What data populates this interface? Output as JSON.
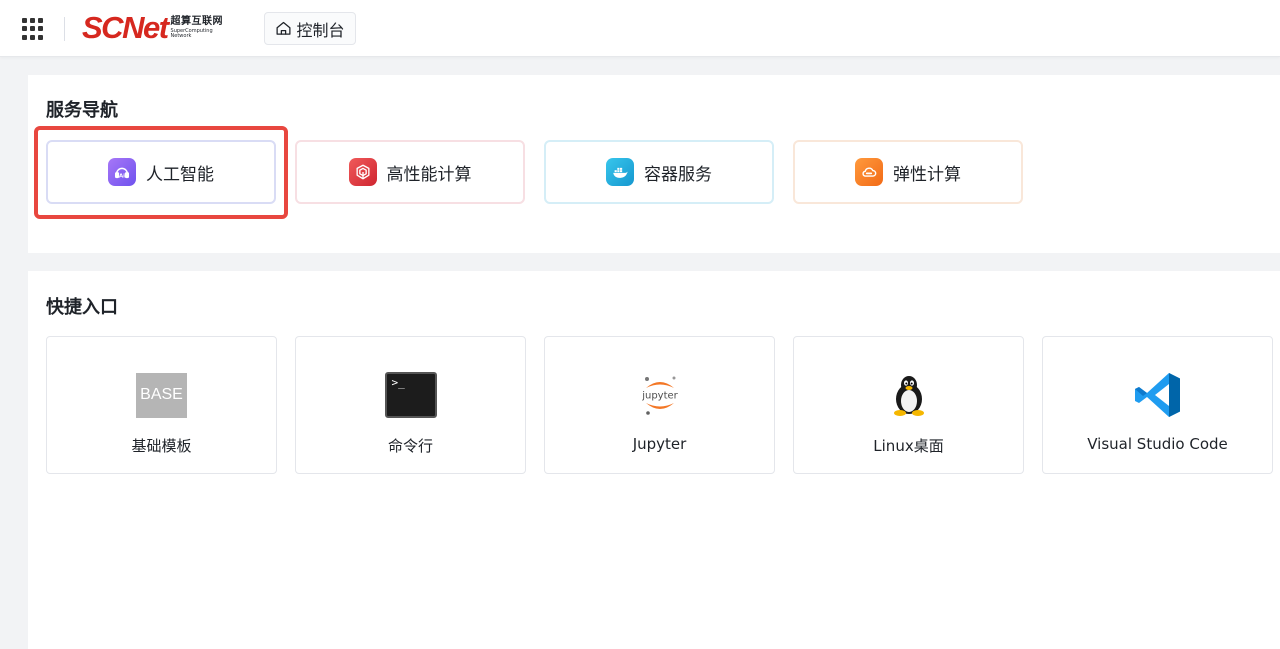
{
  "header": {
    "logo_main": "SCNet",
    "logo_cn": "超算互联网",
    "logo_en_line1": "SuperComputing",
    "logo_en_line2": "Network",
    "console_label": "控制台"
  },
  "service_nav": {
    "title": "服务导航",
    "items": [
      {
        "label": "人工智能",
        "icon": "ai-icon",
        "border_color": "#d9dcf5",
        "icon_color": "#7b5cf5"
      },
      {
        "label": "高性能计算",
        "icon": "hpc-icon",
        "border_color": "#f7dfe3",
        "icon_color": "#e0383e"
      },
      {
        "label": "容器服务",
        "icon": "docker-icon",
        "border_color": "#d5eef7",
        "icon_color": "#1ba7d9"
      },
      {
        "label": "弹性计算",
        "icon": "cloud-icon",
        "border_color": "#f9e7d9",
        "icon_color": "#f6771f"
      }
    ]
  },
  "quick_access": {
    "title": "快捷入口",
    "items": [
      {
        "label": "基础模板",
        "icon": "base-template-icon",
        "badge_text": "BASE"
      },
      {
        "label": "命令行",
        "icon": "terminal-icon",
        "badge_text": ">_"
      },
      {
        "label": "Jupyter",
        "icon": "jupyter-icon",
        "badge_text": "jupyter"
      },
      {
        "label": "Linux桌面",
        "icon": "linux-penguin-icon"
      },
      {
        "label": "Visual Studio Code",
        "icon": "vscode-icon"
      }
    ]
  },
  "colors": {
    "brand_red": "#d6281f",
    "highlight_red": "#e8473f",
    "page_bg": "#f2f3f5"
  }
}
